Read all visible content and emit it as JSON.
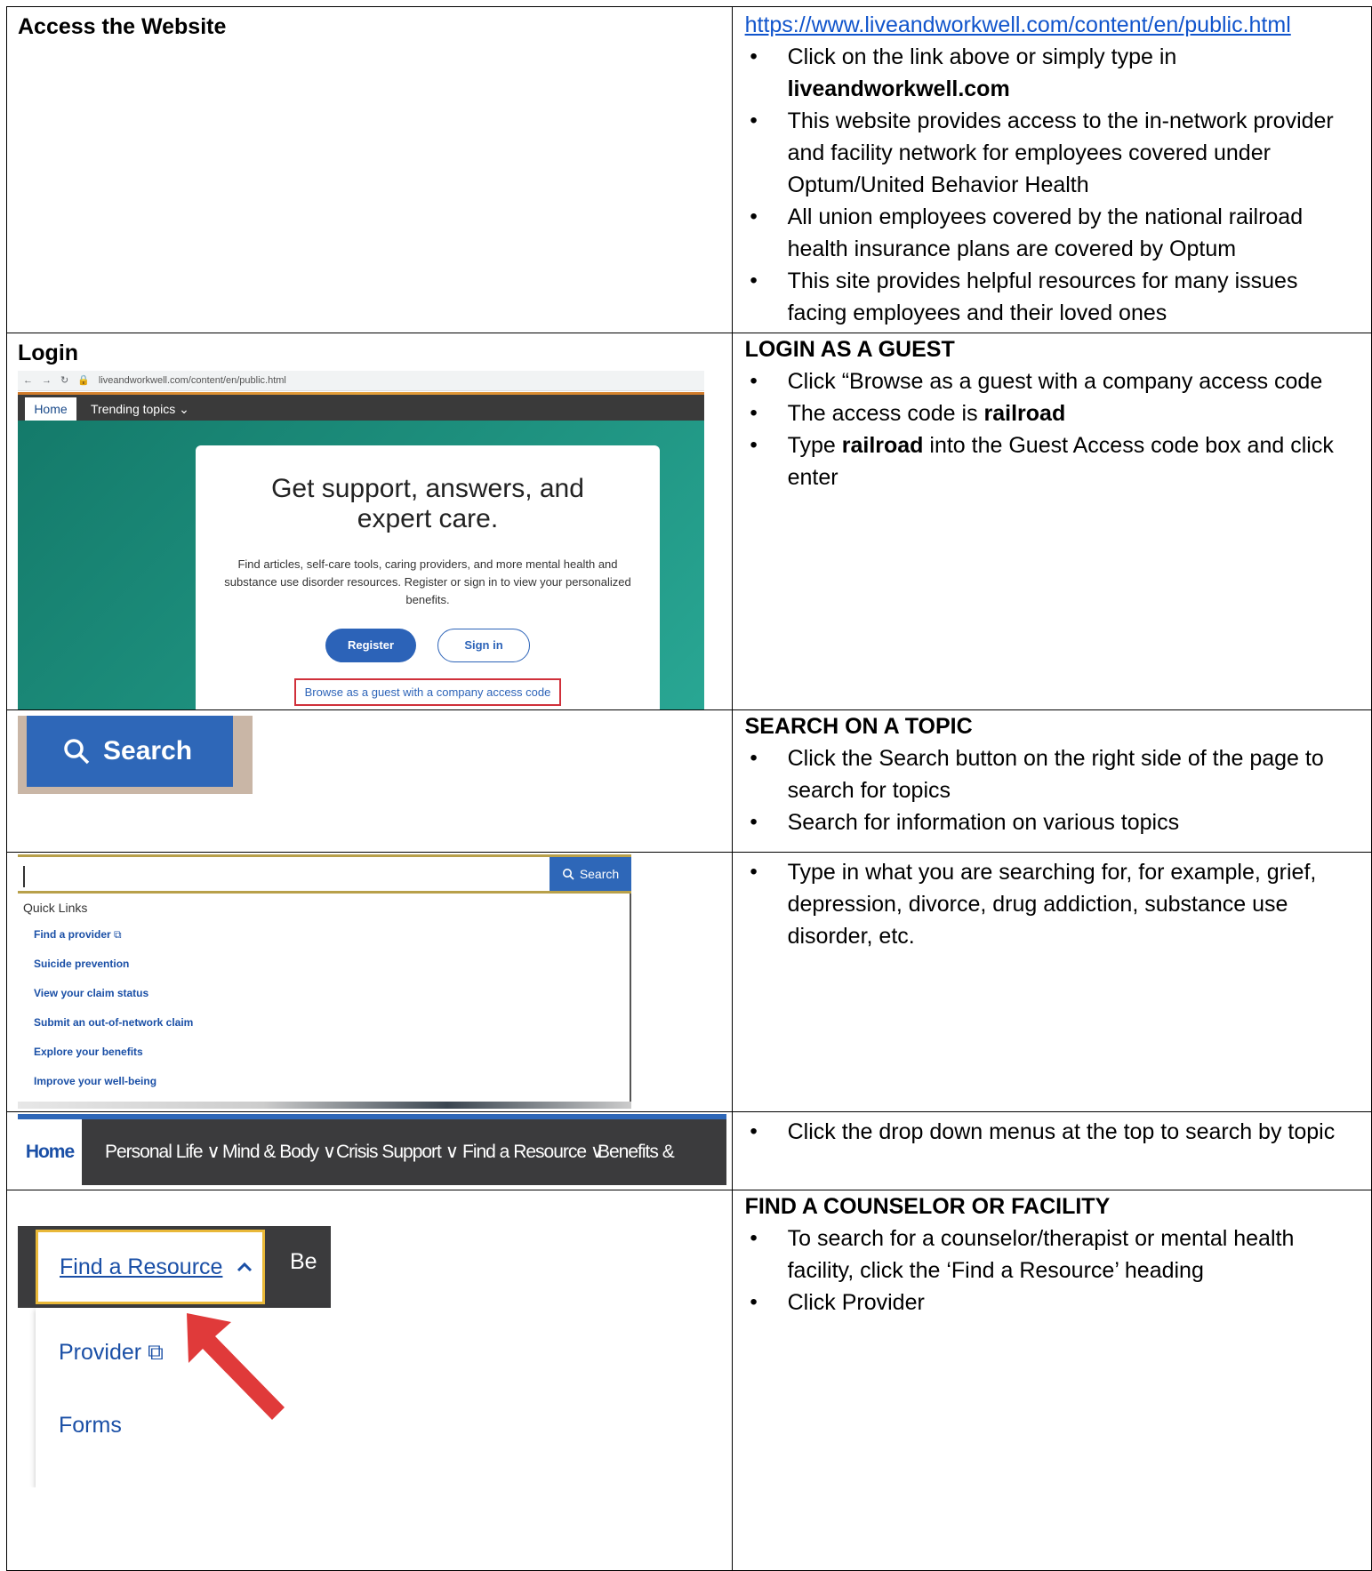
{
  "rows": [
    {
      "left_heading": "Access the Website",
      "link": "https://www.liveandworkwell.com/content/en/public.html",
      "bullets": [
        [
          "Click on the link above or simply type in ",
          "liveandworkwell.com",
          ""
        ],
        [
          "This website provides access to the in-network provider and facility network for employees covered under Optum/United Behavior Health",
          "",
          ""
        ],
        [
          "All union employees covered by the national railroad health insurance plans are covered by Optum",
          "",
          ""
        ],
        [
          "This site provides helpful resources for many issues facing employees and their loved ones",
          "",
          ""
        ]
      ]
    },
    {
      "left_heading": "Login",
      "right_heading": "LOGIN AS A GUEST",
      "bullets": [
        [
          "Click “Browse as a guest with a company access code",
          "",
          ""
        ],
        [
          "The access code is ",
          "railroad",
          ""
        ],
        [
          "Type ",
          "railroad",
          " into the Guest Access code box and click enter"
        ]
      ]
    },
    {
      "right_heading": "SEARCH ON A TOPIC",
      "bullets": [
        [
          "Click the Search button on the right side of the page to search for topics",
          "",
          ""
        ],
        [
          "Search for information on various topics",
          "",
          ""
        ]
      ]
    },
    {
      "bullets": [
        [
          "Type in what you are searching for, for example, grief, depression, divorce, drug addiction, substance use disorder, etc.",
          "",
          ""
        ]
      ]
    },
    {
      "bullets": [
        [
          "Click the drop down menus at the top to search by topic",
          "",
          ""
        ]
      ]
    },
    {
      "right_heading": "FIND A COUNSELOR OR FACILITY",
      "bullets": [
        [
          "To search for a counselor/therapist or mental health facility, click the ‘Find a Resource’ heading",
          "",
          ""
        ],
        [
          "Click Provider",
          "",
          ""
        ]
      ]
    }
  ],
  "login_shot": {
    "url": "liveandworkwell.com/content/en/public.html",
    "nav_home": "Home",
    "nav_trending": "Trending topics",
    "title": "Get support, answers, and expert care.",
    "body": "Find articles, self-care tools, caring providers, and more mental health and substance use disorder resources. Register or sign in to view your personalized benefits.",
    "register": "Register",
    "sign_in": "Sign in",
    "guest": "Browse as a guest with a company access code"
  },
  "search_shot": {
    "label": "Search"
  },
  "dropdown_shot": {
    "button": "Search",
    "quick_links_title": "Quick Links",
    "links": [
      "Find a provider",
      "Suicide prevention",
      "View your claim status",
      "Submit an out-of-network claim",
      "Explore your benefits",
      "Improve your well-being"
    ]
  },
  "nav_shot": {
    "items": [
      "Home",
      "Personal Life",
      "Mind & Body",
      "Crisis Support",
      "Find a Resource",
      "Benefits & Claims"
    ]
  },
  "resource_shot": {
    "button": "Find a Resource",
    "next": "Be",
    "items": [
      "Provider",
      "Forms"
    ]
  },
  "colors": {
    "link": "#1155cc",
    "brand_blue": "#2e67b8",
    "nav_dark": "#3b3b3d",
    "highlight": "#e9b838",
    "arrow": "#e03a3a"
  }
}
